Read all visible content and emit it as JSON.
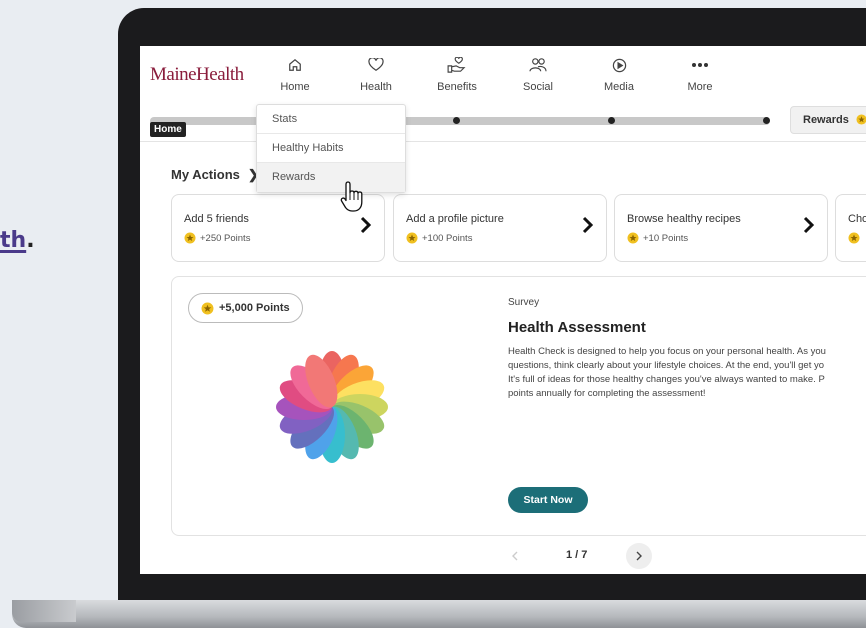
{
  "side_text": {
    "underlined": "th",
    "suffix": "."
  },
  "app": {
    "logo": "MaineHealth"
  },
  "nav": [
    {
      "label": "Home",
      "icon": "home-icon"
    },
    {
      "label": "Health",
      "icon": "heart-icon"
    },
    {
      "label": "Benefits",
      "icon": "hand-heart-icon"
    },
    {
      "label": "Social",
      "icon": "people-icon"
    },
    {
      "label": "Media",
      "icon": "play-icon"
    },
    {
      "label": "More",
      "icon": "more-dots-icon"
    }
  ],
  "progress": {
    "current_chip": "Home",
    "rewards_label": "Rewards"
  },
  "dropdown": {
    "items": [
      "Stats",
      "Healthy Habits",
      "Rewards"
    ],
    "hovered": "Rewards"
  },
  "my_actions": {
    "title": "My Actions",
    "cards": [
      {
        "title": "Add 5 friends",
        "points": "+250 Points"
      },
      {
        "title": "Add a profile picture",
        "points": "+100 Points"
      },
      {
        "title": "Browse healthy recipes",
        "points": "+10 Points"
      },
      {
        "title": "Cho",
        "points": ""
      }
    ]
  },
  "featured": {
    "points": "+5,000 Points",
    "category": "Survey",
    "title": "Health Assessment",
    "description": "Health Check is designed to help you focus on your personal health. As you\nquestions, think clearly about your lifestyle choices. At the end, you'll get yo\nIt's full of ideas for those healthy changes you've always wanted to make. P\npoints annually for completing the assessment!",
    "cta": "Start Now"
  },
  "pagination": {
    "text": "1 / 7"
  },
  "colors": {
    "brand": "#8a1d3c",
    "primary": "#1c6e78",
    "coin": "#f0c020"
  }
}
